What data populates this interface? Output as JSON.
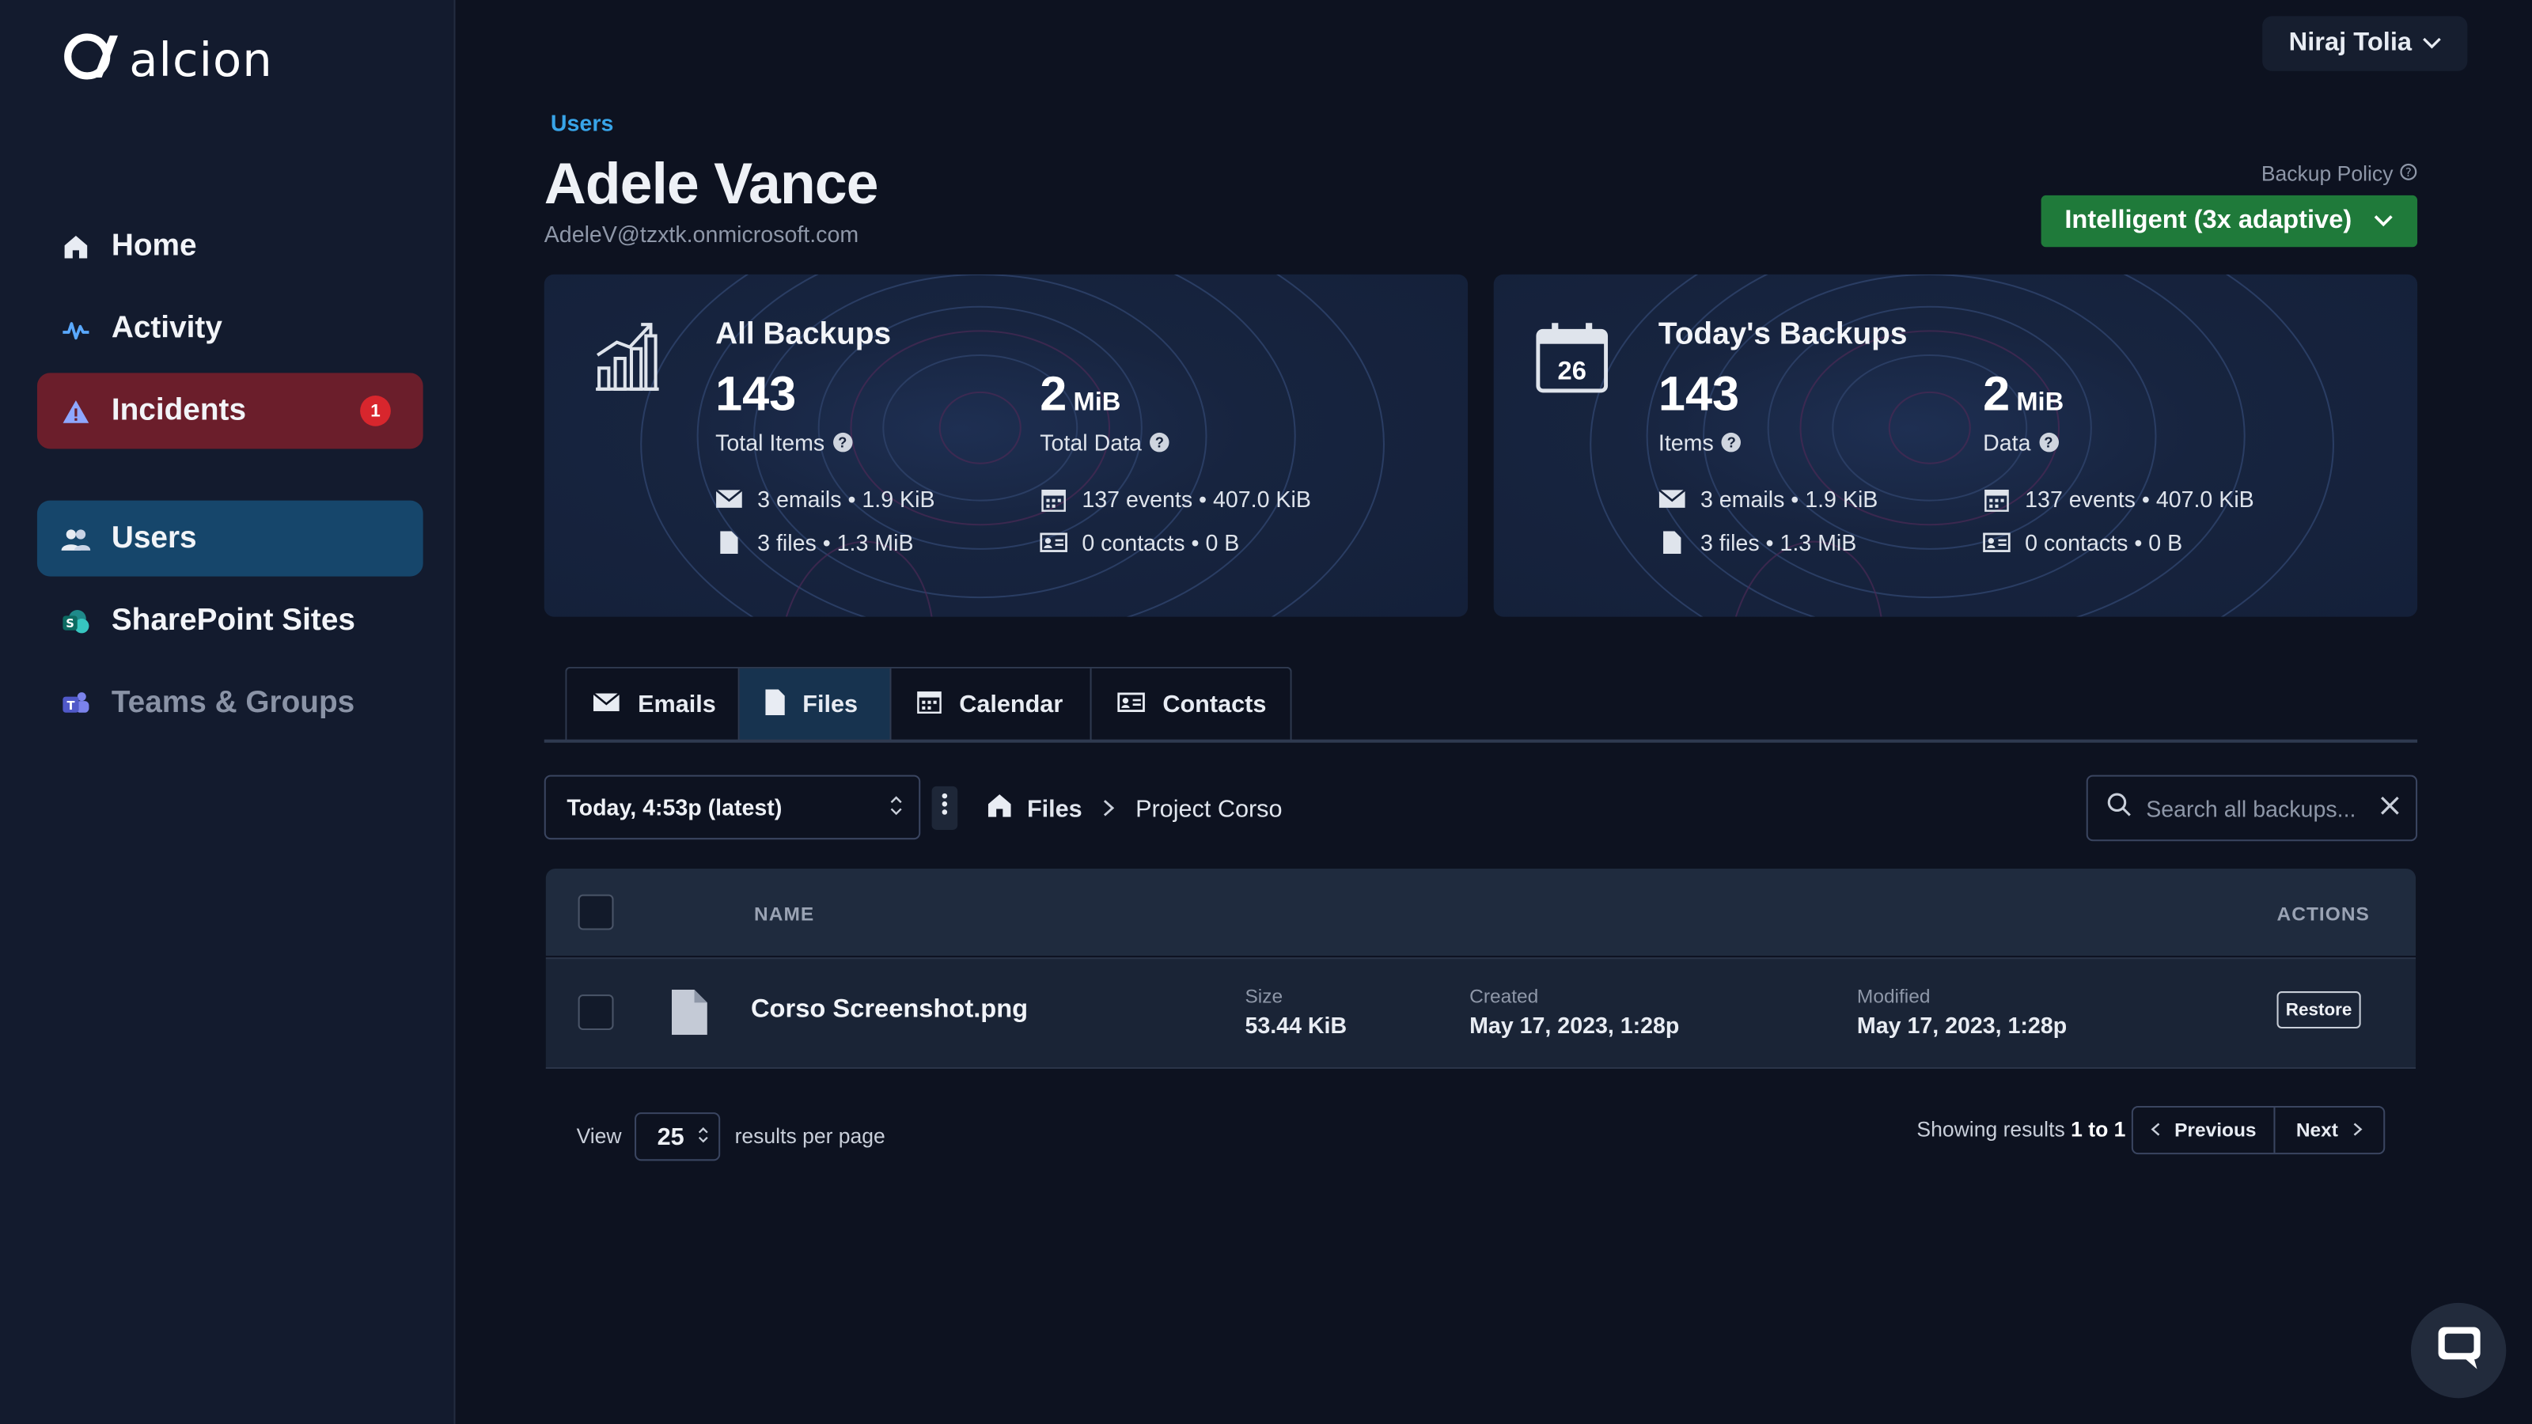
{
  "app": {
    "logo_text": "alcion"
  },
  "sidebar": {
    "items": [
      {
        "label": "Home",
        "icon": "home-icon"
      },
      {
        "label": "Activity",
        "icon": "activity-icon"
      },
      {
        "label": "Incidents",
        "icon": "warning-icon",
        "badge": "1"
      },
      {
        "label": "Users",
        "icon": "users-icon"
      },
      {
        "label": "SharePoint Sites",
        "icon": "sharepoint-icon"
      },
      {
        "label": "Teams & Groups",
        "icon": "teams-icon"
      }
    ]
  },
  "header": {
    "user_name": "Niraj Tolia"
  },
  "page": {
    "breadcrumb": "Users",
    "title": "Adele Vance",
    "email": "AdeleV@tzxtk.onmicrosoft.com",
    "policy_label": "Backup Policy",
    "policy_value": "Intelligent (3x adaptive)"
  },
  "cards": {
    "all": {
      "title": "All Backups",
      "items_value": "143",
      "items_label": "Total Items",
      "data_value": "2",
      "data_unit": "MiB",
      "data_label": "Total Data",
      "emails": "3 emails • 1.9 KiB",
      "files": "3 files • 1.3 MiB",
      "events": "137 events • 407.0 KiB",
      "contacts": "0 contacts • 0 B"
    },
    "today": {
      "title": "Today's Backups",
      "calendar_day": "26",
      "items_value": "143",
      "items_label": "Items",
      "data_value": "2",
      "data_unit": "MiB",
      "data_label": "Data",
      "emails": "3 emails • 1.9 KiB",
      "files": "3 files • 1.3 MiB",
      "events": "137 events • 407.0 KiB",
      "contacts": "0 contacts • 0 B"
    }
  },
  "tabs": [
    {
      "label": "Emails",
      "icon": "envelope-icon"
    },
    {
      "label": "Files",
      "icon": "file-icon",
      "active": true
    },
    {
      "label": "Calendar",
      "icon": "calendar-icon"
    },
    {
      "label": "Contacts",
      "icon": "contact-card-icon"
    }
  ],
  "toolbar": {
    "snapshot": "Today, 4:53p (latest)",
    "path_root": "Files",
    "path_current": "Project Corso",
    "search_placeholder": "Search all backups..."
  },
  "table": {
    "headers": {
      "name": "NAME",
      "actions": "ACTIONS"
    },
    "rows": [
      {
        "name": "Corso Screenshot.png",
        "size_label": "Size",
        "size": "53.44 KiB",
        "created_label": "Created",
        "created": "May 17, 2023, 1:28p",
        "modified_label": "Modified",
        "modified": "May 17, 2023, 1:28p",
        "action": "Restore"
      }
    ]
  },
  "pagination": {
    "view_label": "View",
    "per_page": "25",
    "per_page_label": "results per page",
    "showing_prefix": "Showing results",
    "showing_range": "1 to 1",
    "prev": "Previous",
    "next": "Next"
  },
  "colors": {
    "background": "#0d1220",
    "sidebar": "#131b2e",
    "accent_blue": "#38a4e8",
    "policy_green": "#1f7a3a",
    "incident_red": "#6b1e2b",
    "users_active": "#16466b"
  }
}
